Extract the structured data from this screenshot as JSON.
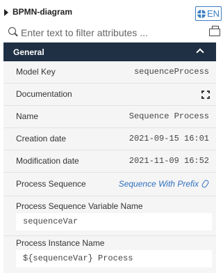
{
  "header": {
    "title": "BPMN-diagram",
    "language": "EN"
  },
  "filter": {
    "placeholder": "Enter text to filter attributes ..."
  },
  "section": {
    "title": "General"
  },
  "properties": {
    "model_key": {
      "label": "Model Key",
      "value": "sequenceProcess"
    },
    "documentation": {
      "label": "Documentation"
    },
    "name": {
      "label": "Name",
      "value": "Sequence Process"
    },
    "creation_date": {
      "label": "Creation date",
      "value": "2021-09-15 16:01"
    },
    "modification_date": {
      "label": "Modification date",
      "value": "2021-11-09 16:52"
    },
    "process_sequence": {
      "label": "Process Sequence",
      "value": "Sequence With Prefix"
    },
    "process_sequence_variable_name": {
      "label": "Process Sequence Variable Name",
      "value": "sequenceVar"
    },
    "process_instance_name": {
      "label": "Process Instance Name",
      "value": "${sequenceVar} Process"
    }
  },
  "colors": {
    "section_header_bg": "#1f3044",
    "link": "#2f6fc0",
    "panel_bg": "#f5f5f5"
  }
}
